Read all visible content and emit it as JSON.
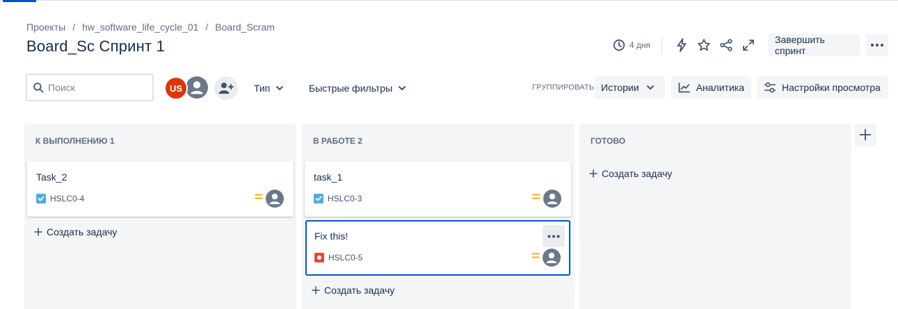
{
  "breadcrumb": [
    "Проекты",
    "hw_software_life_cycle_01",
    "Board_Scram"
  ],
  "breadcrumb_separator": "/",
  "title": "Board_Sc Спринт 1",
  "header": {
    "days_left": "4 дня",
    "complete_sprint": "Завершить спринт"
  },
  "toolbar": {
    "search_placeholder": "Поиск",
    "avatar_initials": "US",
    "type_filter": "Тип",
    "quick_filters": "Быстрые фильтры",
    "group_label": "ГРУППИРОВАТЬ",
    "group_value": "Истории",
    "analytics": "Аналитика",
    "view_settings": "Настройки просмотра"
  },
  "columns": [
    {
      "title": "К ВЫПОЛНЕНИЮ 1",
      "create_label": "Создать задачу",
      "cards": [
        {
          "title": "Task_2",
          "key": "HSLC0-4",
          "type": "task-icon",
          "priority": "medium"
        }
      ]
    },
    {
      "title": "В РАБОТЕ 2",
      "create_label": "Создать задачу",
      "cards": [
        {
          "title": "task_1",
          "key": "HSLC0-3",
          "type": "task-icon",
          "priority": "medium"
        },
        {
          "title": "Fix this!",
          "key": "HSLC0-5",
          "type": "bug-icon",
          "priority": "medium"
        }
      ]
    },
    {
      "title": "ГОТОВО",
      "create_label": "Создать задачу",
      "cards": []
    }
  ],
  "colors": {
    "accent": "#0052cc",
    "avatar": "#de350b",
    "task": "#4bade8",
    "bug": "#e5493a",
    "priority_medium": "#ffab00"
  }
}
